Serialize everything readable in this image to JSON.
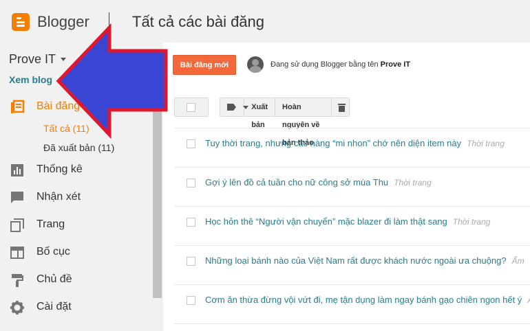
{
  "header": {
    "brand": "Blogger",
    "page_title": "Tất cả các bài đăng"
  },
  "sidebar": {
    "blog_name": "Prove IT",
    "view_blog": "Xem blog",
    "nav": [
      {
        "label": "Bài đăng",
        "icon": "posts-icon",
        "active": true
      },
      {
        "label": "Thống kê",
        "icon": "stats-icon"
      },
      {
        "label": "Nhận xét",
        "icon": "comments-icon"
      },
      {
        "label": "Trang",
        "icon": "pages-icon"
      },
      {
        "label": "Bố cục",
        "icon": "layout-icon"
      },
      {
        "label": "Chủ đề",
        "icon": "theme-icon"
      },
      {
        "label": "Cài đặt",
        "icon": "settings-icon"
      }
    ],
    "sub": [
      {
        "label": "Tất cả (11)",
        "active": true
      },
      {
        "label": "Đã xuất bản (11)"
      }
    ]
  },
  "main": {
    "new_post": "Bài đăng mới",
    "using_prefix": "Đang sử dụng Blogger bằng tên ",
    "using_name": "Prove IT",
    "toolbar": {
      "publish": "Xuất bản",
      "revert": "Hoàn nguyên về bản thảo"
    },
    "posts": [
      {
        "title": "Tuy thời trang, nhưng các nàng “mi nhon” chớ nên diện item này",
        "label": "Thời trang"
      },
      {
        "title": "Gợi ý lên đồ cả tuần cho nữ công sở mùa Thu",
        "label": "Thời trang"
      },
      {
        "title": "Học hỏn thê “Người vận chuyển” mặc blazer đi làm thật sang",
        "label": "Thời trang"
      },
      {
        "title": "Những loại bánh nào của Việt Nam rất được khách nước ngoài ưa chuộng?",
        "label": "Ẩm"
      },
      {
        "title": "Cơm ăn thừa đừng vội vứt đi, mẹ tận dụng làm ngay bánh gạo chiên ngon hết ý",
        "label": "Ẩm"
      }
    ]
  },
  "colors": {
    "accent": "#f57d00",
    "link": "#2a7c8c",
    "new_post_button": "#f2683a",
    "annotation_arrow_fill": "#3b45d4",
    "annotation_arrow_stroke": "#e0182d"
  }
}
